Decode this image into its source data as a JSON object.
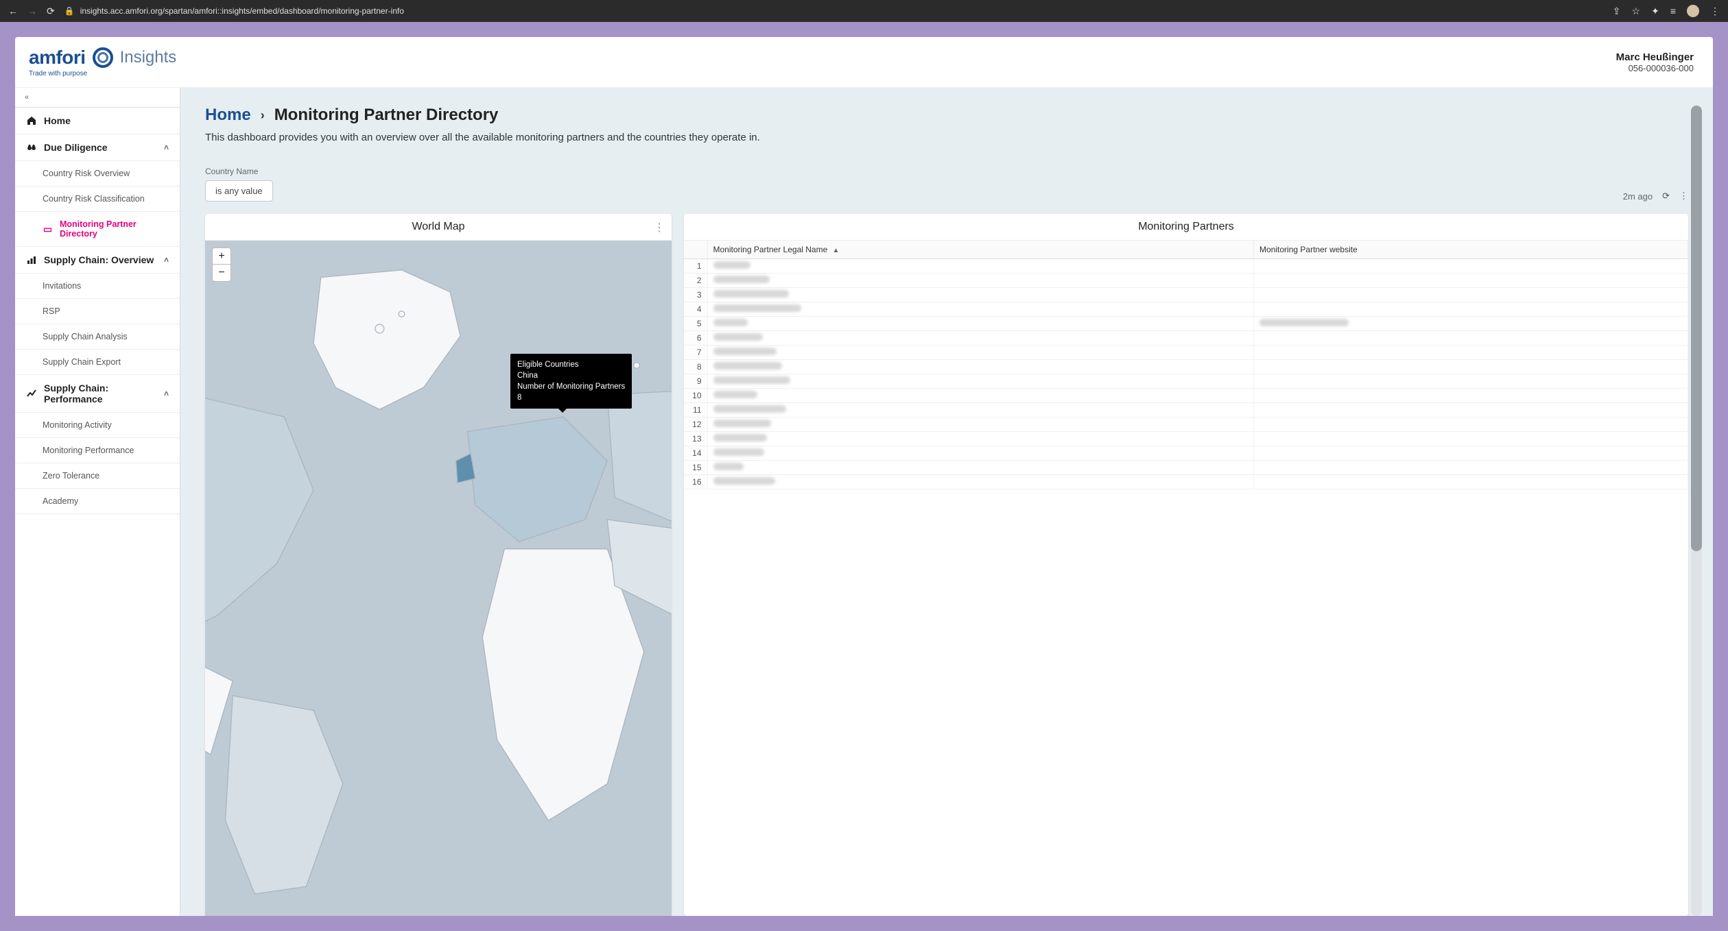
{
  "browser": {
    "url": "insights.acc.amfori.org/spartan/amfori::insights/embed/dashboard/monitoring-partner-info"
  },
  "brand": {
    "name": "amfori",
    "product": "Insights",
    "tagline": "Trade with purpose"
  },
  "user": {
    "name": "Marc Heußinger",
    "id": "056-000036-000"
  },
  "sidebar": {
    "home": "Home",
    "sections": [
      {
        "key": "due-diligence",
        "label": "Due Diligence",
        "icon": "scale",
        "expanded": true,
        "items": [
          {
            "label": "Country Risk Overview",
            "active": false
          },
          {
            "label": "Country Risk Classification",
            "active": false
          },
          {
            "label": "Monitoring Partner Directory",
            "active": true
          }
        ]
      },
      {
        "key": "sc-overview",
        "label": "Supply Chain: Overview",
        "icon": "bars",
        "expanded": true,
        "items": [
          {
            "label": "Invitations",
            "active": false
          },
          {
            "label": "RSP",
            "active": false
          },
          {
            "label": "Supply Chain Analysis",
            "active": false
          },
          {
            "label": "Supply Chain Export",
            "active": false
          }
        ]
      },
      {
        "key": "sc-performance",
        "label": "Supply Chain: Performance",
        "icon": "chart",
        "expanded": true,
        "items": [
          {
            "label": "Monitoring Activity",
            "active": false
          },
          {
            "label": "Monitoring Performance",
            "active": false
          },
          {
            "label": "Zero Tolerance",
            "active": false
          },
          {
            "label": "Academy",
            "active": false
          }
        ]
      }
    ]
  },
  "page": {
    "breadcrumb_home": "Home",
    "title": "Monitoring Partner Directory",
    "subtitle": "This dashboard provides you with an overview over all the available monitoring partners and the countries they operate in.",
    "filter_label": "Country Name",
    "filter_chip": "is any value",
    "status_time": "2m ago"
  },
  "map": {
    "title": "World Map",
    "zoom_in": "+",
    "zoom_out": "−",
    "tooltip": {
      "line1": "Eligible Countries",
      "line2": "China",
      "line3": "Number of Monitoring Partners",
      "line4": "8"
    }
  },
  "partners": {
    "title": "Monitoring Partners",
    "columns": {
      "name": "Monitoring Partner Legal Name",
      "website": "Monitoring Partner website"
    },
    "rows": [
      {
        "n": "1",
        "name_w": 54,
        "site_w": 0
      },
      {
        "n": "2",
        "name_w": 82,
        "site_w": 0
      },
      {
        "n": "3",
        "name_w": 110,
        "site_w": 0
      },
      {
        "n": "4",
        "name_w": 128,
        "site_w": 0
      },
      {
        "n": "5",
        "name_w": 50,
        "site_w": 130
      },
      {
        "n": "6",
        "name_w": 72,
        "site_w": 0
      },
      {
        "n": "7",
        "name_w": 92,
        "site_w": 0
      },
      {
        "n": "8",
        "name_w": 100,
        "site_w": 0
      },
      {
        "n": "9",
        "name_w": 112,
        "site_w": 0
      },
      {
        "n": "10",
        "name_w": 64,
        "site_w": 0
      },
      {
        "n": "11",
        "name_w": 106,
        "site_w": 0
      },
      {
        "n": "12",
        "name_w": 84,
        "site_w": 0
      },
      {
        "n": "13",
        "name_w": 78,
        "site_w": 0
      },
      {
        "n": "14",
        "name_w": 74,
        "site_w": 0
      },
      {
        "n": "15",
        "name_w": 44,
        "site_w": 0
      },
      {
        "n": "16",
        "name_w": 90,
        "site_w": 0
      }
    ]
  }
}
